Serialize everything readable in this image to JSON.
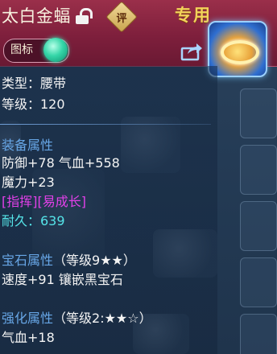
{
  "header": {
    "item_name": "太白金蝠",
    "review_badge": "评",
    "exclusive_label": "专用",
    "icon_toggle_label": "图标"
  },
  "icons": {
    "lock": "unlock-icon",
    "review": "review-badge-icon",
    "share": "share-icon",
    "item": "belt-item-icon"
  },
  "details": {
    "type_line": "类型：腰带",
    "level_line": "等级：120"
  },
  "equipment": {
    "heading": "装备属性",
    "lines": [
      "防御+78 气血+558",
      "魔力+23"
    ],
    "special": "[指挥][易成长]",
    "durability": "耐久：639"
  },
  "gem": {
    "heading": "宝石属性",
    "detail": "（等级9★★）",
    "line": "速度+91 镶嵌黑宝石"
  },
  "enhance": {
    "heading": "强化属性",
    "detail": "（等级2:★★☆）",
    "line": "气血+18"
  },
  "colors": {
    "header_bg": "#7e1f3c",
    "title": "#f7f1df",
    "exclusive": "#f2d35a",
    "section_heading": "#67a6e6",
    "special": "#e240e8",
    "durability": "#55e4e8",
    "toggle_on": "#35d6a8"
  }
}
